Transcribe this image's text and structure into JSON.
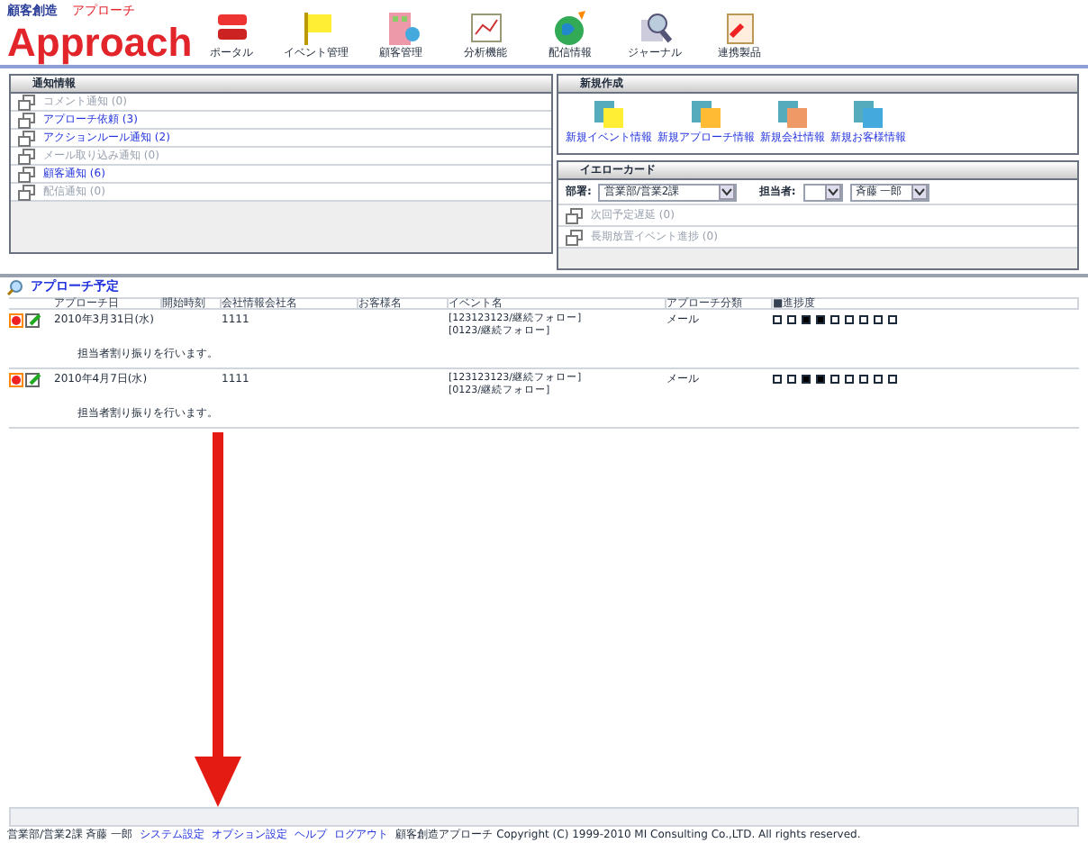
{
  "logo": {
    "small": "顧客創造",
    "main": "Approach",
    "sub": "アプローチ"
  },
  "nav": [
    {
      "label": "ポータル",
      "kind": "portal"
    },
    {
      "label": "イベント管理",
      "kind": "event"
    },
    {
      "label": "顧客管理",
      "kind": "customer"
    },
    {
      "label": "分析機能",
      "kind": "analysis"
    },
    {
      "label": "配信情報",
      "kind": "delivery"
    },
    {
      "label": "ジャーナル",
      "kind": "journal"
    },
    {
      "label": "連携製品",
      "kind": "link"
    }
  ],
  "notices": {
    "title": "通知情報",
    "items": [
      {
        "label": "コメント通知 (0)",
        "active": false
      },
      {
        "label": "アプローチ依頼 (3)",
        "active": true
      },
      {
        "label": "アクションルール通知 (2)",
        "active": true
      },
      {
        "label": "メール取り込み通知 (0)",
        "active": false
      },
      {
        "label": "顧客通知 (6)",
        "active": true
      },
      {
        "label": "配信通知 (0)",
        "active": false
      }
    ]
  },
  "create": {
    "title": "新規作成",
    "items": [
      {
        "label": "新規イベント情報",
        "kind": "event"
      },
      {
        "label": "新規アプローチ情報",
        "kind": "approach"
      },
      {
        "label": "新規会社情報",
        "kind": "company"
      },
      {
        "label": "新規お客様情報",
        "kind": "customer"
      }
    ]
  },
  "yellow_card": {
    "title": "イエローカード",
    "dept_label": "部署:",
    "dept_value": "営業部/営業2課",
    "owner_label": "担当者:",
    "owner_value": "斉藤 一郎",
    "items": [
      {
        "label": "次回予定遅延 (0)",
        "active": false
      },
      {
        "label": "長期放置イベント進捗 (0)",
        "active": false
      }
    ]
  },
  "schedule": {
    "title": "アプローチ予定",
    "columns": [
      "アプローチ日",
      "開始時刻",
      "会社情報会社名",
      "お客様名",
      "イベント名",
      "アプローチ分類",
      "■進捗度"
    ],
    "rows": [
      {
        "date": "2010年3月31日(水)",
        "company": "1111",
        "events": [
          "[123123123/継続フォロー]",
          "[0123/継続フォロー]"
        ],
        "category": "メール",
        "progress": [
          false,
          false,
          true,
          true,
          false,
          false,
          false,
          false,
          false
        ],
        "note": "担当者割り振りを行います。"
      },
      {
        "date": "2010年4月7日(水)",
        "company": "1111",
        "events": [
          "[123123123/継続フォロー]",
          "[0123/継続フォロー]"
        ],
        "category": "メール",
        "progress": [
          false,
          false,
          true,
          true,
          false,
          false,
          false,
          false,
          false
        ],
        "note": "担当者割り振りを行います。"
      }
    ]
  },
  "footer": {
    "user": "営業部/営業2課 斉藤 一郎",
    "links": [
      "システム設定",
      "オプション設定",
      "ヘルプ",
      "ログアウト"
    ],
    "copyright": "顧客創造アプローチ Copyright (C) 1999-2010 MI Consulting Co.,LTD. All rights reserved."
  }
}
